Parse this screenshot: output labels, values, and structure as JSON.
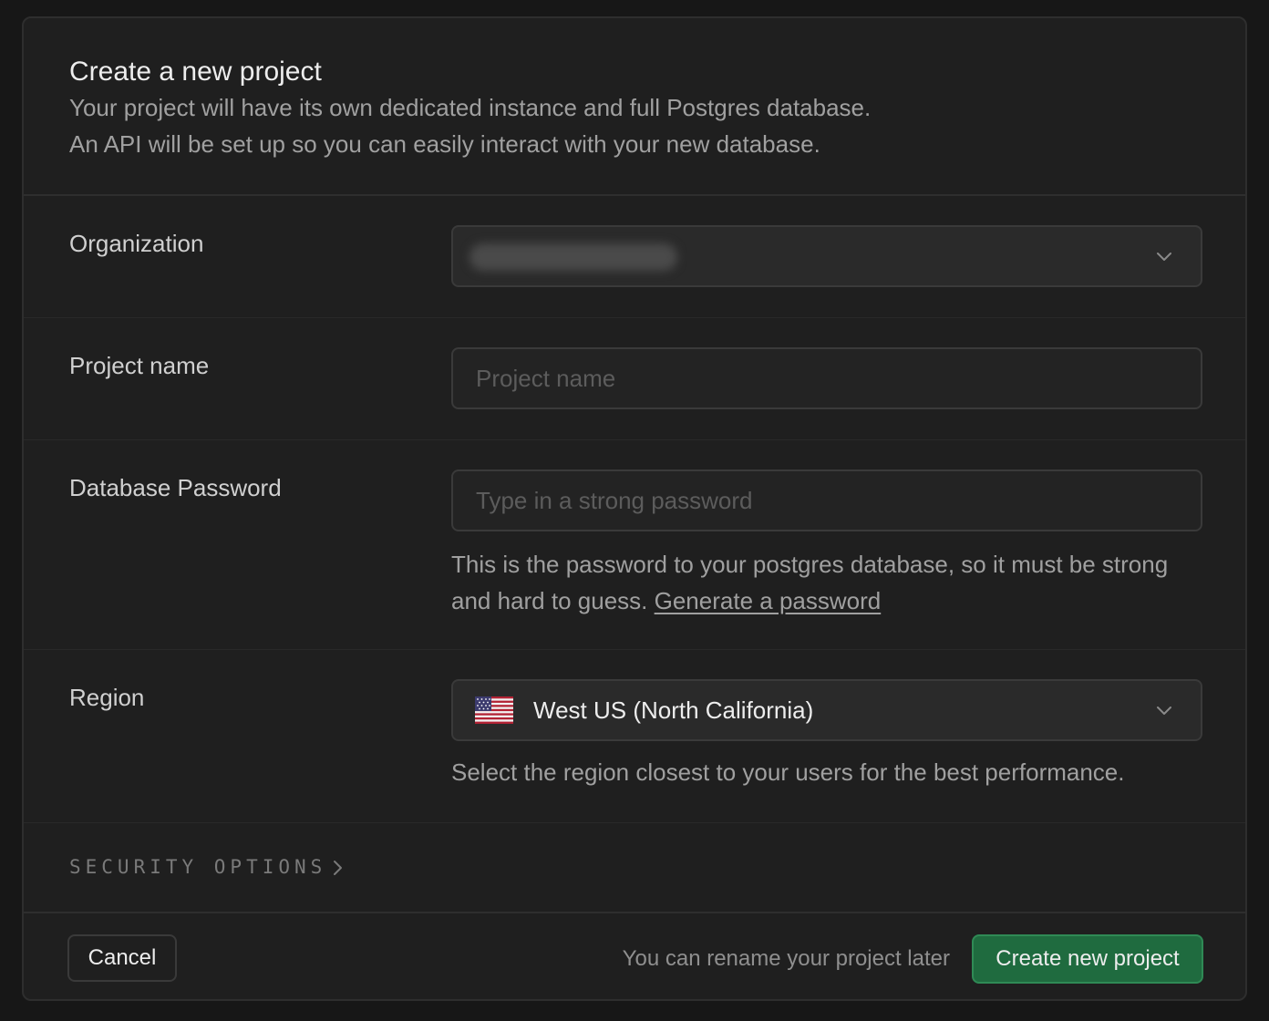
{
  "header": {
    "title": "Create a new project",
    "subtitle_line1": "Your project will have its own dedicated instance and full Postgres database.",
    "subtitle_line2": "An API will be set up so you can easily interact with your new database."
  },
  "organization": {
    "label": "Organization",
    "value_redacted": true
  },
  "project_name": {
    "label": "Project name",
    "placeholder": "Project name",
    "value": ""
  },
  "database_password": {
    "label": "Database Password",
    "placeholder": "Type in a strong password",
    "value": "",
    "help_text": "This is the password to your postgres database, so it must be strong and hard to guess.",
    "generate_link": "Generate a password"
  },
  "region": {
    "label": "Region",
    "selected": "West US (North California)",
    "flag_icon": "us-flag-icon",
    "help_text": "Select the region closest to your users for the best performance."
  },
  "security_options": {
    "label": "SECURITY OPTIONS"
  },
  "footer": {
    "cancel_label": "Cancel",
    "note": "You can rename your project later",
    "create_label": "Create new project"
  },
  "colors": {
    "background": "#171717",
    "panel": "#1f1f1f",
    "primary_button": "#1f6b3f",
    "text": "#ededed",
    "muted_text": "#a0a0a0"
  }
}
